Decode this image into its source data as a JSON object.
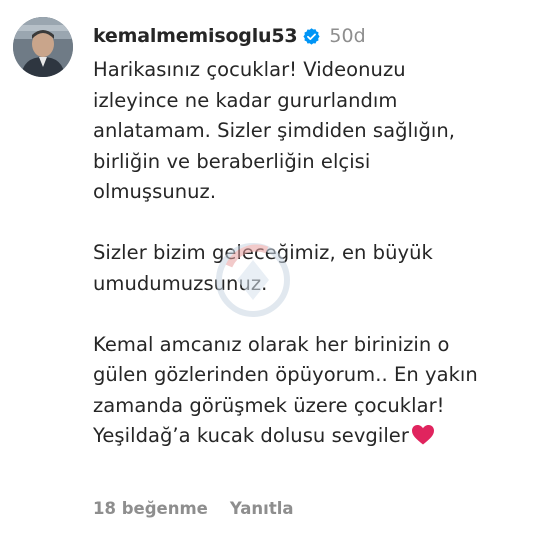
{
  "comment": {
    "username": "kemalmemisoglu53",
    "verified_icon": "verified-badge-icon",
    "time_ago": "50d",
    "paragraphs": [
      [
        "Harikasınız çocuklar! Videonuzu",
        "izleyince ne kadar gururlandım",
        "anlatamam. Sizler şimdiden sağlığın,",
        "birliğin ve beraberliğin elçisi",
        "olmuşsunuz."
      ],
      [
        "Sizler bizim geleceğimiz, en büyük",
        "umudumuzsunuz."
      ],
      [
        "Kemal amcanız olarak her birinizin o",
        "gülen gözlerinden öpüyorum.. En yakın",
        "zamanda görüşmek üzere çocuklar!",
        "Yeşildağ’a kucak dolusu sevgiler"
      ]
    ],
    "emoji": "red-heart-icon",
    "likes_label": "18 beğenme",
    "reply_label": "Yanıtla"
  },
  "colors": {
    "text": "#262626",
    "muted": "#8e8e8e",
    "verified_blue": "#0095f6",
    "heart_red": "#e0245e"
  }
}
